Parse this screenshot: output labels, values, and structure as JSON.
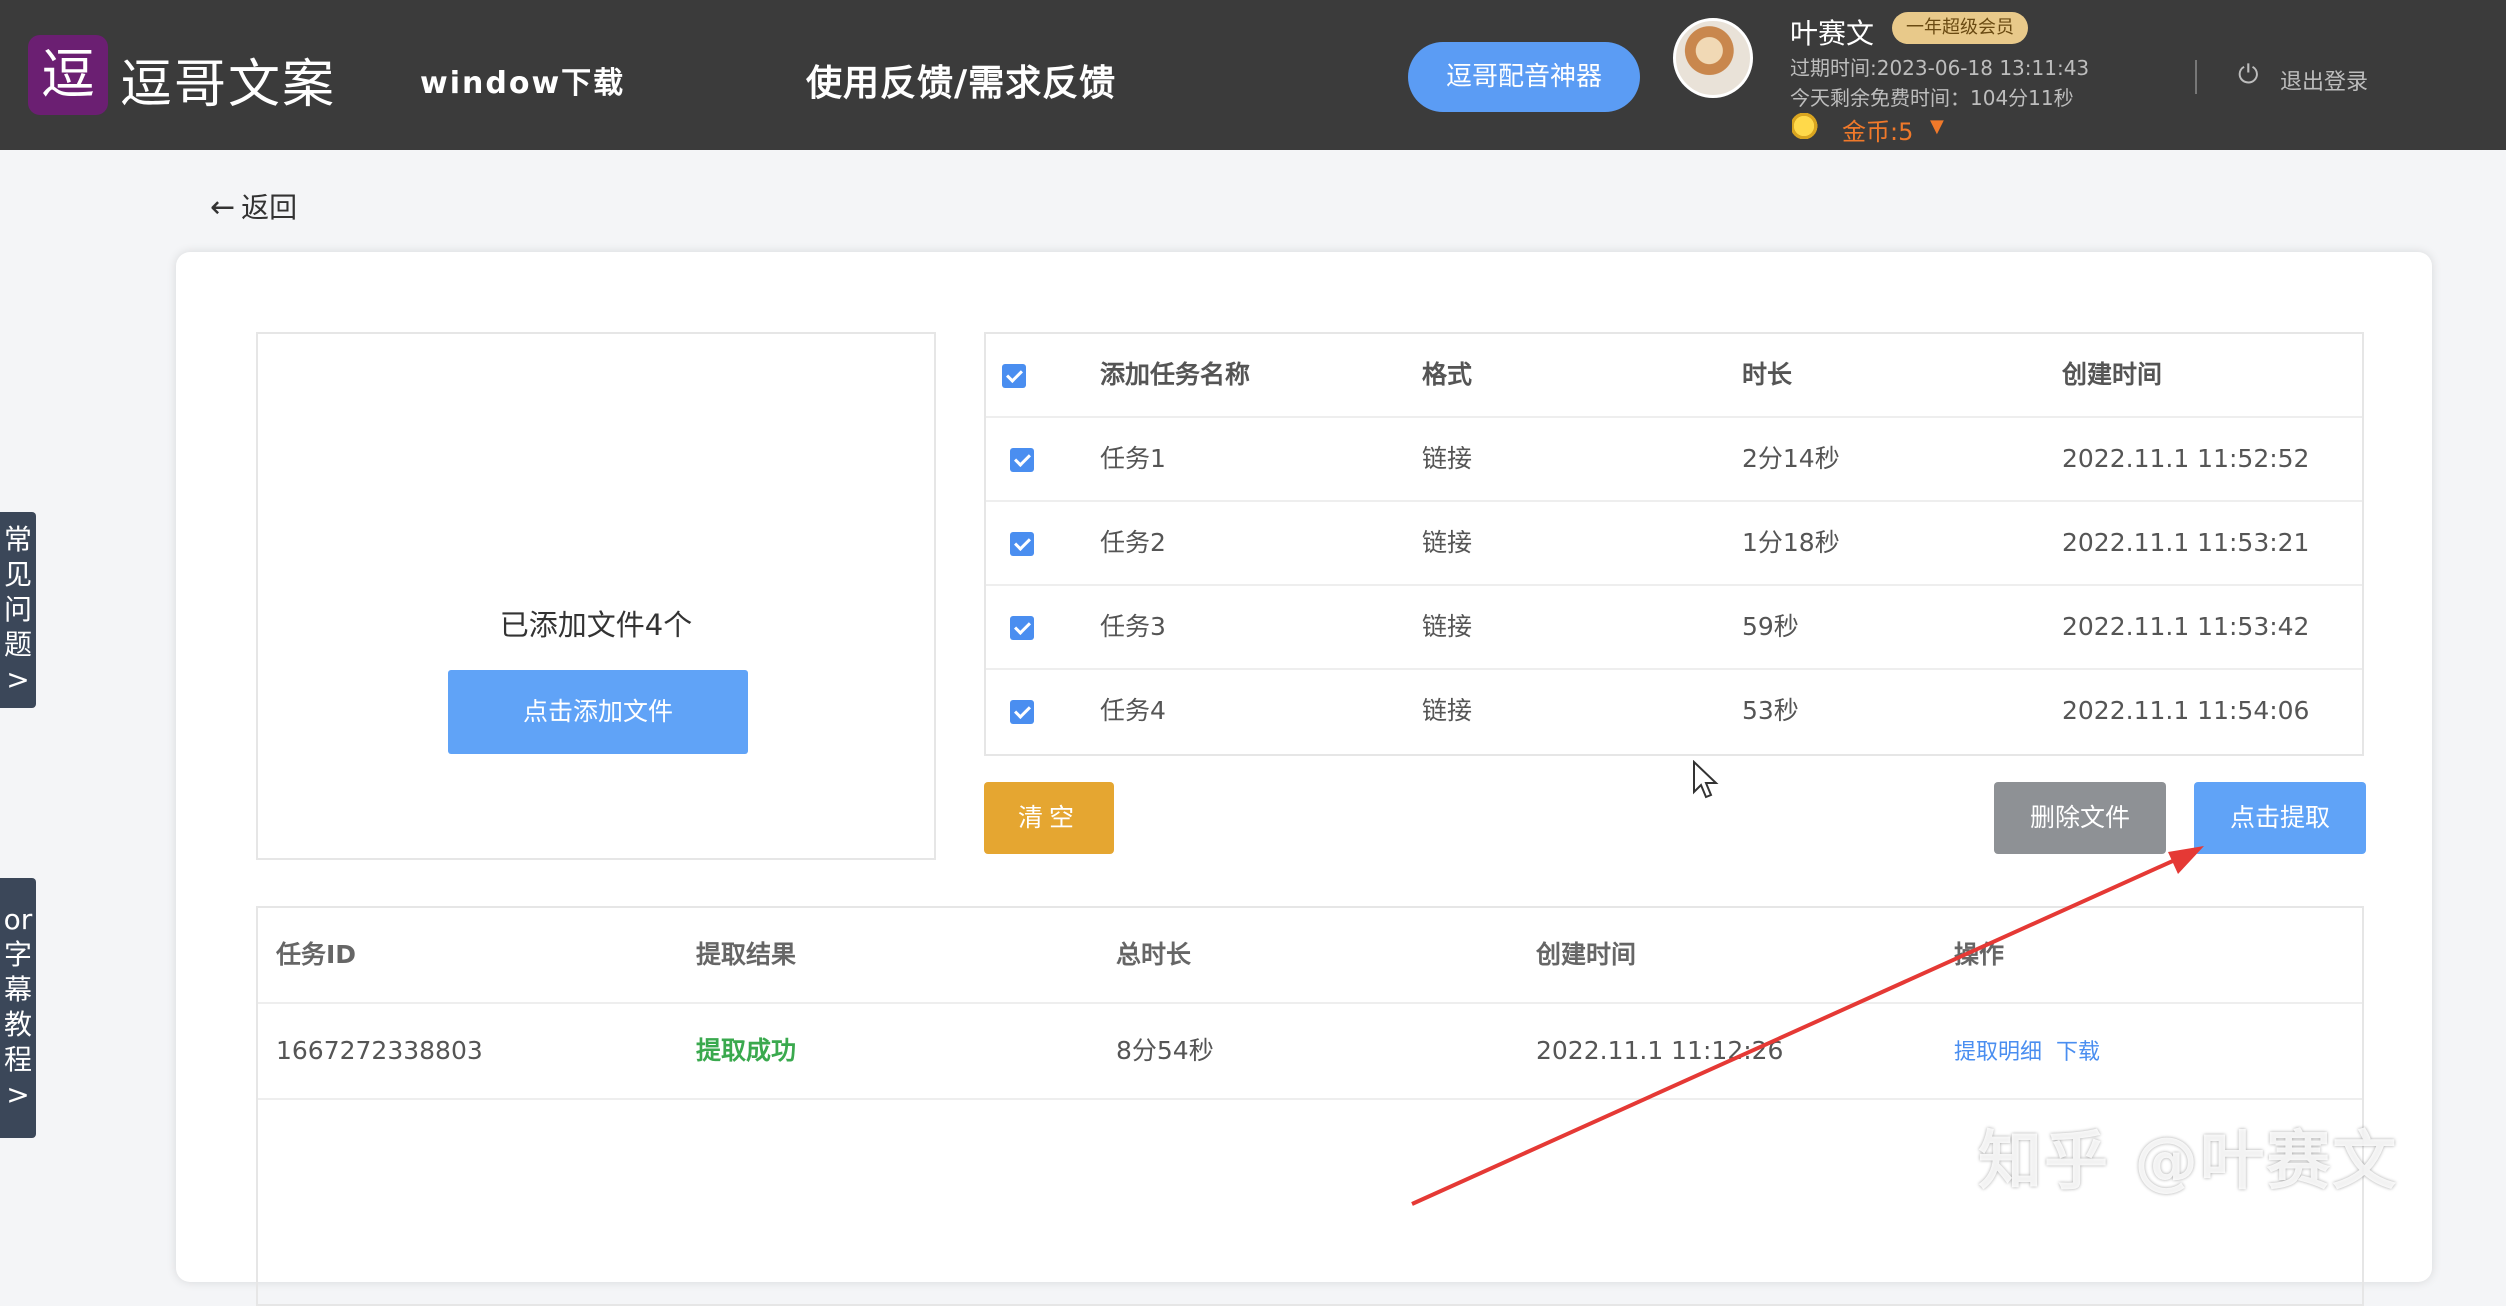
{
  "header": {
    "logo_icon": "doudou-logo-icon",
    "logo_text": "逗哥文案",
    "nav_download": "window下载",
    "nav_feedback": "使用反馈/需求反馈",
    "dub_button": "逗哥配音神器",
    "user": {
      "name": "叶赛文",
      "badge": "一年超级会员",
      "expire": "过期时间:2023-06-18 13:11:43",
      "free_time": "今天剩余免费时间：104分11秒",
      "coins": "金币:5"
    },
    "logout": "退出登录"
  },
  "back_label": "返回",
  "side_tabs": {
    "faq": [
      "常",
      "见",
      "问",
      "题",
      ">"
    ],
    "tutorial": [
      "or",
      "字",
      "幕",
      "教",
      "程",
      ">"
    ]
  },
  "upload": {
    "count_text": "已添加文件4个",
    "add_button": "点击添加文件"
  },
  "task_table": {
    "headers": [
      "添加任务名称",
      "格式",
      "时长",
      "创建时间"
    ],
    "rows": [
      {
        "name": "任务1",
        "format": "链接",
        "duration": "2分14秒",
        "created": "2022.11.1 11:52:52",
        "checked": true
      },
      {
        "name": "任务2",
        "format": "链接",
        "duration": "1分18秒",
        "created": "2022.11.1 11:53:21",
        "checked": true
      },
      {
        "name": "任务3",
        "format": "链接",
        "duration": "59秒",
        "created": "2022.11.1 11:53:42",
        "checked": true
      },
      {
        "name": "任务4",
        "format": "链接",
        "duration": "53秒",
        "created": "2022.11.1 11:54:06",
        "checked": true
      }
    ]
  },
  "actions": {
    "clear": "清空",
    "delete": "删除文件",
    "extract": "点击提取"
  },
  "result_table": {
    "headers": [
      "任务ID",
      "提取结果",
      "总时长",
      "创建时间",
      "操作"
    ],
    "rows": [
      {
        "id": "1667272338803",
        "result": "提取成功",
        "total": "8分54秒",
        "created": "2022.11.1 11:12:26",
        "op_detail": "提取明细",
        "op_download": "下载"
      }
    ]
  },
  "watermark": "知乎 @叶赛文",
  "colors": {
    "header_bg": "#3b3b3b",
    "primary": "#60a3f7",
    "clear_btn": "#e5a631",
    "delete_btn": "#8e9195",
    "success": "#3aa94e",
    "annotation_arrow": "#e53935"
  }
}
